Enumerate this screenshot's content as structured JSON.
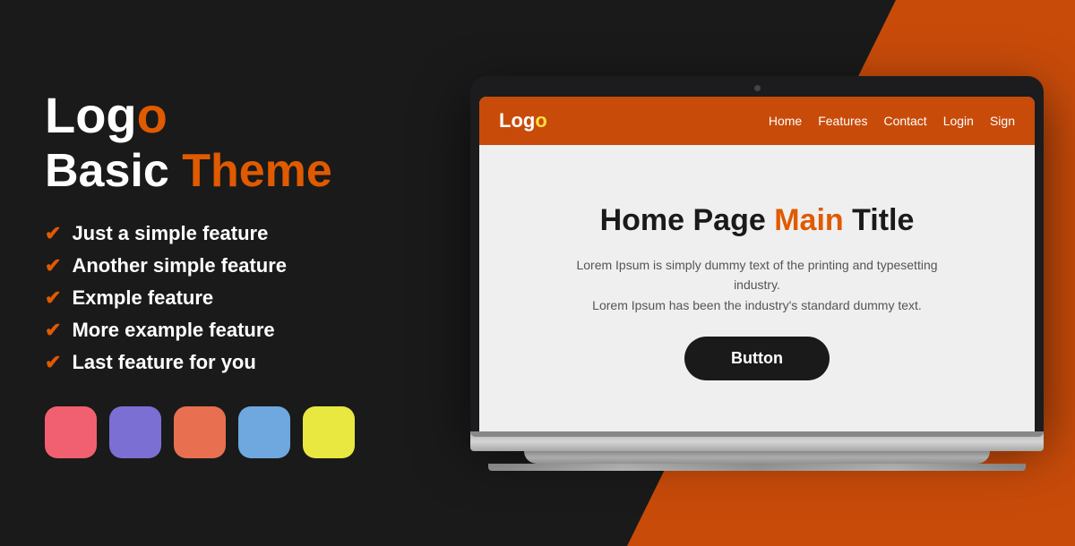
{
  "left": {
    "logo": {
      "text": "Logo",
      "accent_char": "o"
    },
    "tagline": {
      "plain": "Basic ",
      "accent": "Theme"
    },
    "features": [
      "Just a simple feature",
      "Another simple feature",
      "Exmple feature",
      "More example feature",
      "Last feature for you"
    ],
    "swatches": [
      {
        "color": "#f06070",
        "name": "red-swatch"
      },
      {
        "color": "#7b6fd4",
        "name": "purple-swatch"
      },
      {
        "color": "#e87050",
        "name": "orange-swatch"
      },
      {
        "color": "#6ea8de",
        "name": "blue-swatch"
      },
      {
        "color": "#e8e840",
        "name": "yellow-swatch"
      }
    ]
  },
  "screen": {
    "navbar": {
      "logo": "Logo",
      "links": [
        "Home",
        "Features",
        "Contact",
        "Login",
        "Sign"
      ]
    },
    "content": {
      "title_plain": "Home Page ",
      "title_accent": "Main",
      "title_end": " Title",
      "description": "Lorem Ipsum is simply dummy text of the printing and typesetting industry.\nLorem Ipsum has been the industry's standard dummy text.",
      "button_label": "Button"
    }
  }
}
